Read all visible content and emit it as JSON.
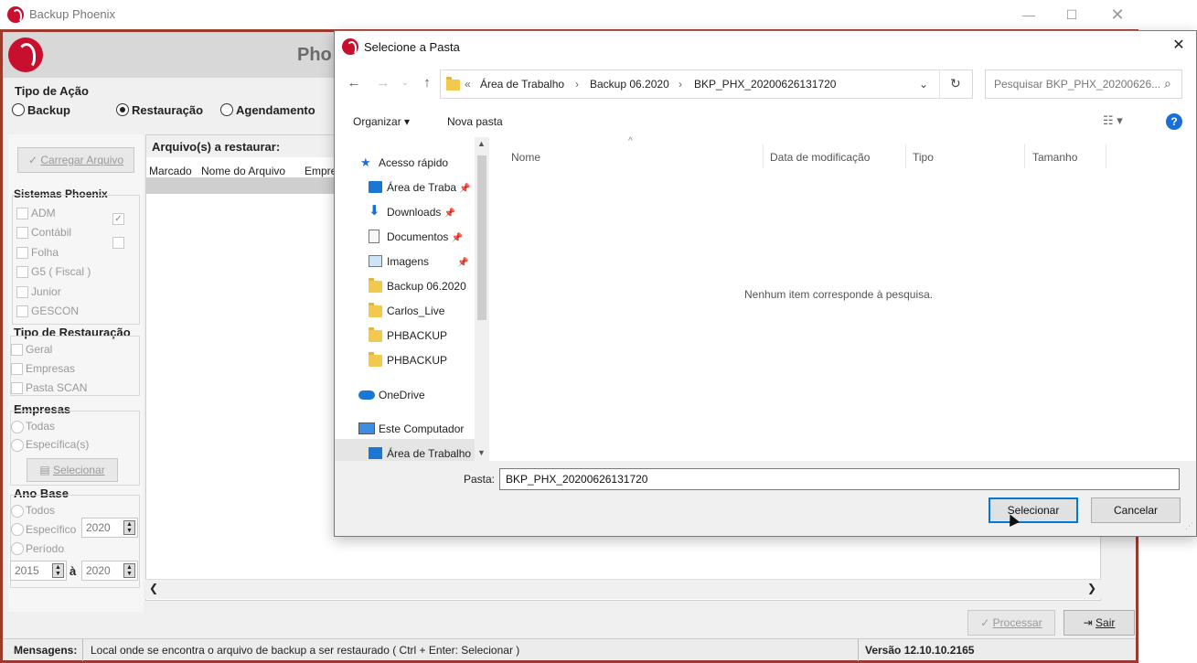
{
  "main": {
    "window_title": "Backup Phoenix",
    "header_title": "Pho",
    "tipo_acao": {
      "title": "Tipo de Ação",
      "options": [
        "Backup",
        "Restauração",
        "Agendamento"
      ],
      "selected": "Restauração"
    },
    "carregar_arquivo_label": "Carregar Arquivo",
    "sistemas": {
      "title": "Sistemas Phoenix",
      "items": [
        "ADM",
        "Contábil",
        "Folha",
        "G5 ( Fiscal )",
        "Junior",
        "GESCON"
      ]
    },
    "tipo_restauracao": {
      "title": "Tipo de Restauração",
      "items": [
        "Geral",
        "Empresas",
        "Pasta SCAN"
      ]
    },
    "empresas": {
      "title": "Empresas",
      "options": [
        "Todas",
        "Específica(s)"
      ],
      "selecionar_label": "Selecionar"
    },
    "ano_base": {
      "title": "Ano Base",
      "options": [
        "Todos",
        "Específico",
        "Período"
      ],
      "especifico_value": "2020",
      "periodo_from": "2015",
      "periodo_sep": "à",
      "periodo_to": "2020"
    },
    "files": {
      "title": "Arquivo(s) a restaurar:",
      "columns": [
        "Marcado",
        "Nome do Arquivo",
        "Empre"
      ]
    },
    "processar_label": "Processar",
    "sair_label": "Sair",
    "status": {
      "label": "Mensagens:",
      "message": "Local onde se encontra o arquivo de backup a ser restaurado ( Ctrl + Enter: Selecionar )",
      "version": "Versão 12.10.10.2165"
    }
  },
  "dialog": {
    "title": "Selecione a Pasta",
    "breadcrumb_prefix": "«",
    "breadcrumb": [
      "Área de Trabalho",
      "Backup 06.2020",
      "BKP_PHX_20200626131720"
    ],
    "search_placeholder": "Pesquisar BKP_PHX_20200626...",
    "toolbar": {
      "organizar": "Organizar",
      "nova_pasta": "Nova pasta"
    },
    "nav": [
      {
        "label": "Acesso rápido",
        "icon": "star-icon"
      },
      {
        "label": "Área de Traba",
        "icon": "desktop-icon",
        "pinned": true
      },
      {
        "label": "Downloads",
        "icon": "download-icon",
        "pinned": true
      },
      {
        "label": "Documentos",
        "icon": "document-icon",
        "pinned": true
      },
      {
        "label": "Imagens",
        "icon": "image-icon",
        "pinned": true
      },
      {
        "label": "Backup 06.2020",
        "icon": "folder-icon"
      },
      {
        "label": "Carlos_Live",
        "icon": "folder-icon"
      },
      {
        "label": "PHBACKUP",
        "icon": "folder-icon"
      },
      {
        "label": "PHBACKUP",
        "icon": "folder-icon"
      },
      {
        "label": "OneDrive",
        "icon": "cloud-icon"
      },
      {
        "label": "Este Computador",
        "icon": "computer-icon"
      },
      {
        "label": "Área de Trabalho",
        "icon": "desktop-icon"
      }
    ],
    "columns": [
      "Nome",
      "Data de modificação",
      "Tipo",
      "Tamanho"
    ],
    "empty_message": "Nenhum item corresponde à pesquisa.",
    "pasta_label": "Pasta:",
    "pasta_value": "BKP_PHX_20200626131720",
    "selecionar_label": "Selecionar",
    "cancelar_label": "Cancelar",
    "colors": {
      "accent": "#0078d7",
      "help": "#1a6ed8",
      "folder": "#f2c94c"
    }
  }
}
